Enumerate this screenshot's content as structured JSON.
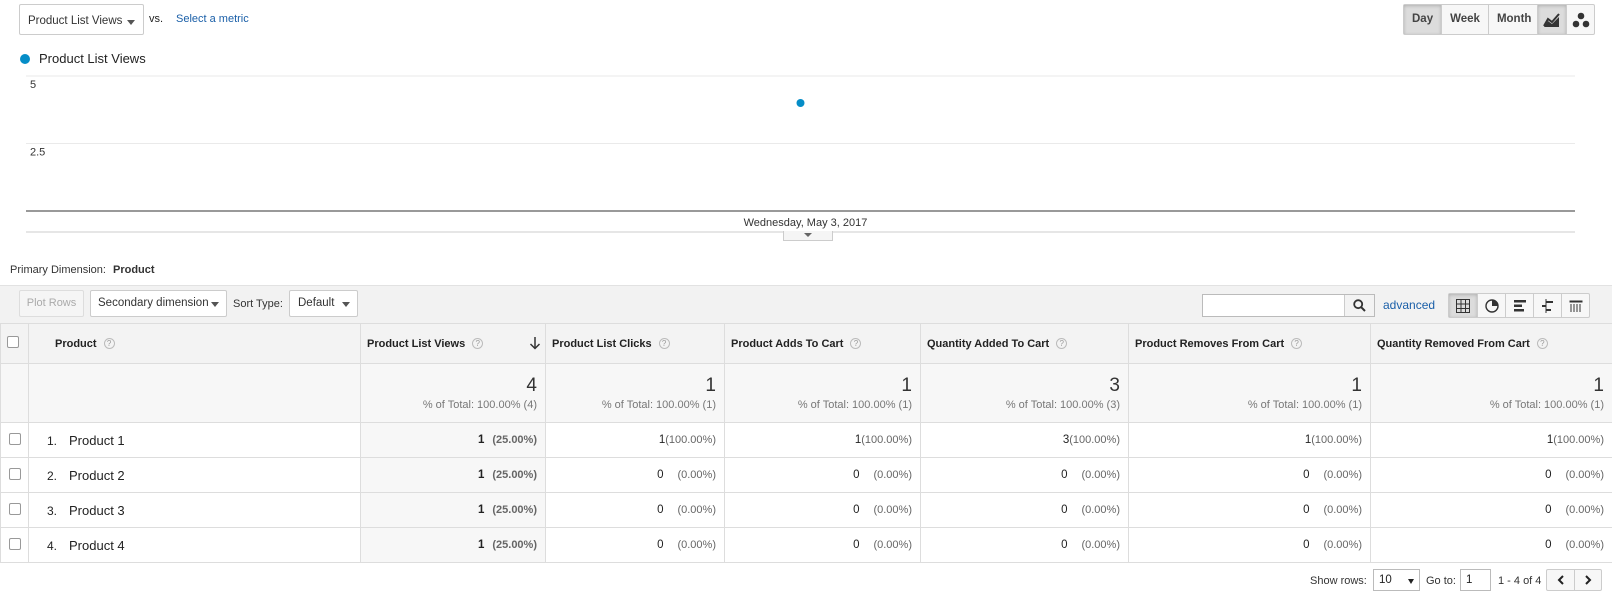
{
  "header": {
    "metric": "Product List Views",
    "vs": "vs.",
    "select_metric": "Select a metric",
    "periods": [
      "Day",
      "Week",
      "Month"
    ],
    "chart_types": [
      "line-chart-icon",
      "motion-chart-icon"
    ]
  },
  "legend": {
    "label": "Product List Views",
    "color": "#058dc7"
  },
  "chart_data": {
    "type": "scatter",
    "series": [
      {
        "name": "Product List Views",
        "color": "#058dc7",
        "values": [
          4
        ]
      }
    ],
    "x": [
      "Wednesday, May 3, 2017"
    ],
    "x_label": "Wednesday, May 3, 2017",
    "y_ticks": [
      5,
      2.5
    ],
    "ylim": [
      0,
      5
    ],
    "grid": true
  },
  "primary_dimension": {
    "label": "Primary Dimension:",
    "value": "Product"
  },
  "toolbar": {
    "plot_rows": "Plot Rows",
    "secondary_dimension": "Secondary dimension",
    "sort_type_label": "Sort Type:",
    "sort_type_value": "Default",
    "search_value": "",
    "advanced": "advanced"
  },
  "table": {
    "columns": [
      {
        "label": "Product"
      },
      {
        "label": "Product List Views",
        "sorted": "desc"
      },
      {
        "label": "Product List Clicks"
      },
      {
        "label": "Product Adds To Cart"
      },
      {
        "label": "Quantity Added To Cart"
      },
      {
        "label": "Product Removes From Cart"
      },
      {
        "label": "Quantity Removed From Cart"
      }
    ],
    "totals": [
      {
        "value": "4",
        "pct": "% of Total: 100.00% (4)"
      },
      {
        "value": "1",
        "pct": "% of Total: 100.00% (1)"
      },
      {
        "value": "1",
        "pct": "% of Total: 100.00% (1)"
      },
      {
        "value": "3",
        "pct": "% of Total: 100.00% (3)"
      },
      {
        "value": "1",
        "pct": "% of Total: 100.00% (1)"
      },
      {
        "value": "1",
        "pct": "% of Total: 100.00% (1)"
      }
    ],
    "rows": [
      {
        "num": "1.",
        "name": "Product 1",
        "cells": [
          [
            "1",
            "(25.00%)"
          ],
          [
            "1",
            "(100.00%)"
          ],
          [
            "1",
            "(100.00%)"
          ],
          [
            "3",
            "(100.00%)"
          ],
          [
            "1",
            "(100.00%)"
          ],
          [
            "1",
            "(100.00%)"
          ]
        ]
      },
      {
        "num": "2.",
        "name": "Product 2",
        "cells": [
          [
            "1",
            "(25.00%)"
          ],
          [
            "0",
            "(0.00%)"
          ],
          [
            "0",
            "(0.00%)"
          ],
          [
            "0",
            "(0.00%)"
          ],
          [
            "0",
            "(0.00%)"
          ],
          [
            "0",
            "(0.00%)"
          ]
        ]
      },
      {
        "num": "3.",
        "name": "Product 3",
        "cells": [
          [
            "1",
            "(25.00%)"
          ],
          [
            "0",
            "(0.00%)"
          ],
          [
            "0",
            "(0.00%)"
          ],
          [
            "0",
            "(0.00%)"
          ],
          [
            "0",
            "(0.00%)"
          ],
          [
            "0",
            "(0.00%)"
          ]
        ]
      },
      {
        "num": "4.",
        "name": "Product 4",
        "cells": [
          [
            "1",
            "(25.00%)"
          ],
          [
            "0",
            "(0.00%)"
          ],
          [
            "0",
            "(0.00%)"
          ],
          [
            "0",
            "(0.00%)"
          ],
          [
            "0",
            "(0.00%)"
          ],
          [
            "0",
            "(0.00%)"
          ]
        ]
      }
    ]
  },
  "footer": {
    "show_rows_label": "Show rows:",
    "show_rows_value": "10",
    "goto_label": "Go to:",
    "goto_value": "1",
    "range": "1 - 4 of 4"
  }
}
